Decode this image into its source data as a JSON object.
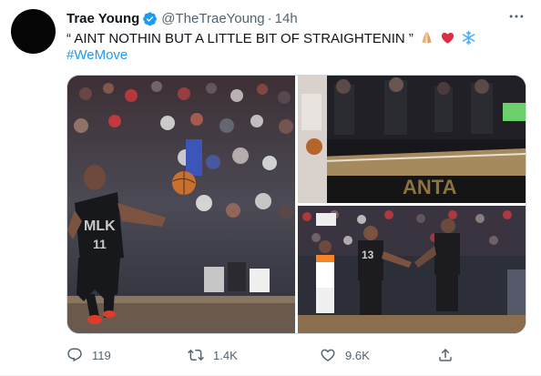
{
  "tweet": {
    "display_name": "Trae Young",
    "handle": "@TheTraeYoung",
    "separator": "·",
    "time": "14h",
    "text": "“ AINT NOTHIN BUT A LITTLE BIT OF STRAIGHTENIN ”",
    "emojis": [
      "folded-hands",
      "red-heart",
      "snowflake"
    ],
    "hashtag": "#WeMove",
    "jersey_main": "MLK",
    "jersey_number": "11",
    "jersey_number_2": "13",
    "court_text": "ANTA",
    "counts": {
      "replies": "119",
      "retweets": "1.4K",
      "likes": "9.6K"
    }
  },
  "colors": {
    "link": "#1d9bf0",
    "text_secondary": "#536471",
    "verified": "#1d9bf0",
    "heart": "#e0245e"
  }
}
